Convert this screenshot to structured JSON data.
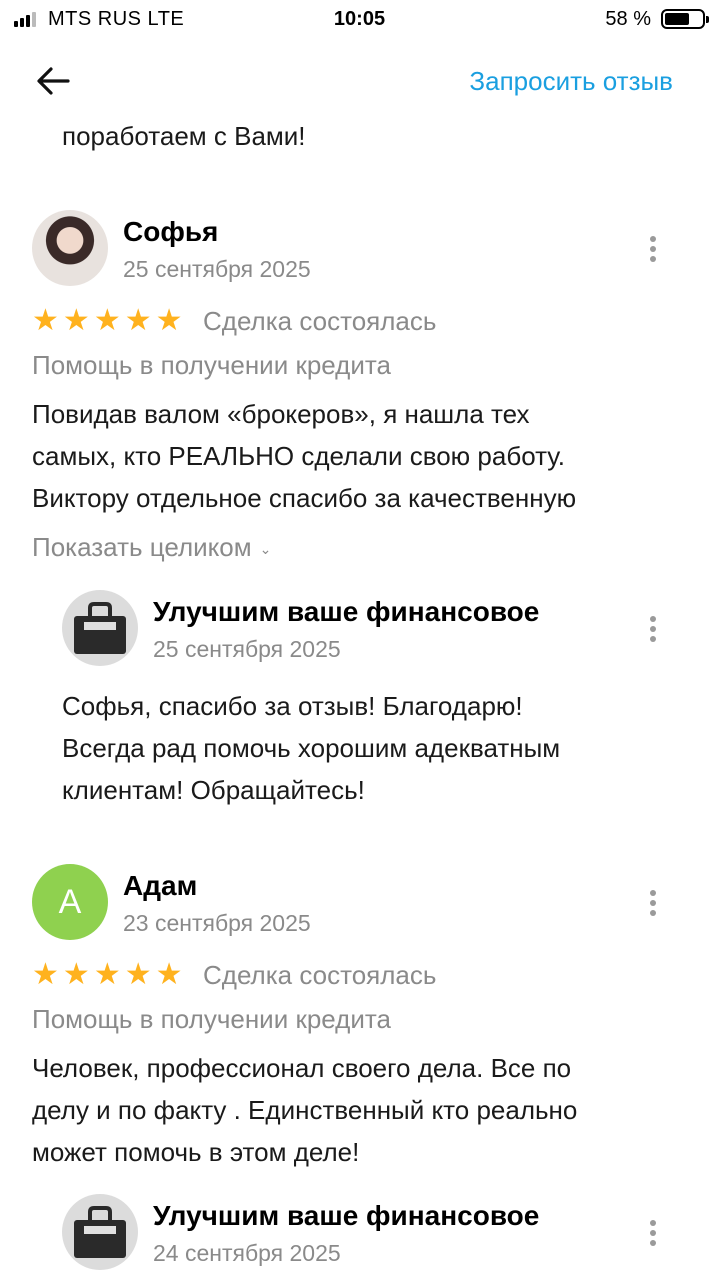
{
  "status_bar": {
    "carrier": "MTS RUS  LTE",
    "time": "10:05",
    "battery": "58 %"
  },
  "nav": {
    "back_icon": "arrow-left-icon",
    "request_review": "Запросить отзыв"
  },
  "previous_tail": "поработаем с Вами!",
  "reviews": [
    {
      "author": "Софья",
      "date": "25 сентября 2025",
      "rating": 5,
      "deal_status": "Сделка состоялась",
      "category": "Помощь в получении кредита",
      "text_lines": [
        "Повидав валом «брокеров», я нашла тех",
        "самых, кто РЕАЛЬНО сделали свою работу.",
        "Виктору отдельное спасибо за качественную"
      ],
      "show_more": "Показать целиком",
      "reply": {
        "author": "Улучшим ваше финансовое",
        "date": "25 сентября 2025",
        "text_lines": [
          "Софья, спасибо за отзыв! Благодарю!",
          "Всегда рад помочь хорошим адекватным",
          "клиентам! Обращайтесь!"
        ]
      }
    },
    {
      "author": "Адам",
      "avatar_letter": "A",
      "date": "23 сентября 2025",
      "rating": 5,
      "deal_status": "Сделка состоялась",
      "category": "Помощь в получении кредита",
      "text_lines": [
        "Человек, профессионал своего дела. Все по",
        "делу и по факту . Единственный кто реально",
        "может помочь в этом деле!"
      ],
      "reply": {
        "author": "Улучшим ваше финансовое",
        "date": "24 сентября 2025"
      }
    }
  ],
  "colors": {
    "accent": "#1a9fe0",
    "star": "#ffb21e",
    "muted": "#8a8a8a",
    "avatar_green": "#8fd14f"
  }
}
